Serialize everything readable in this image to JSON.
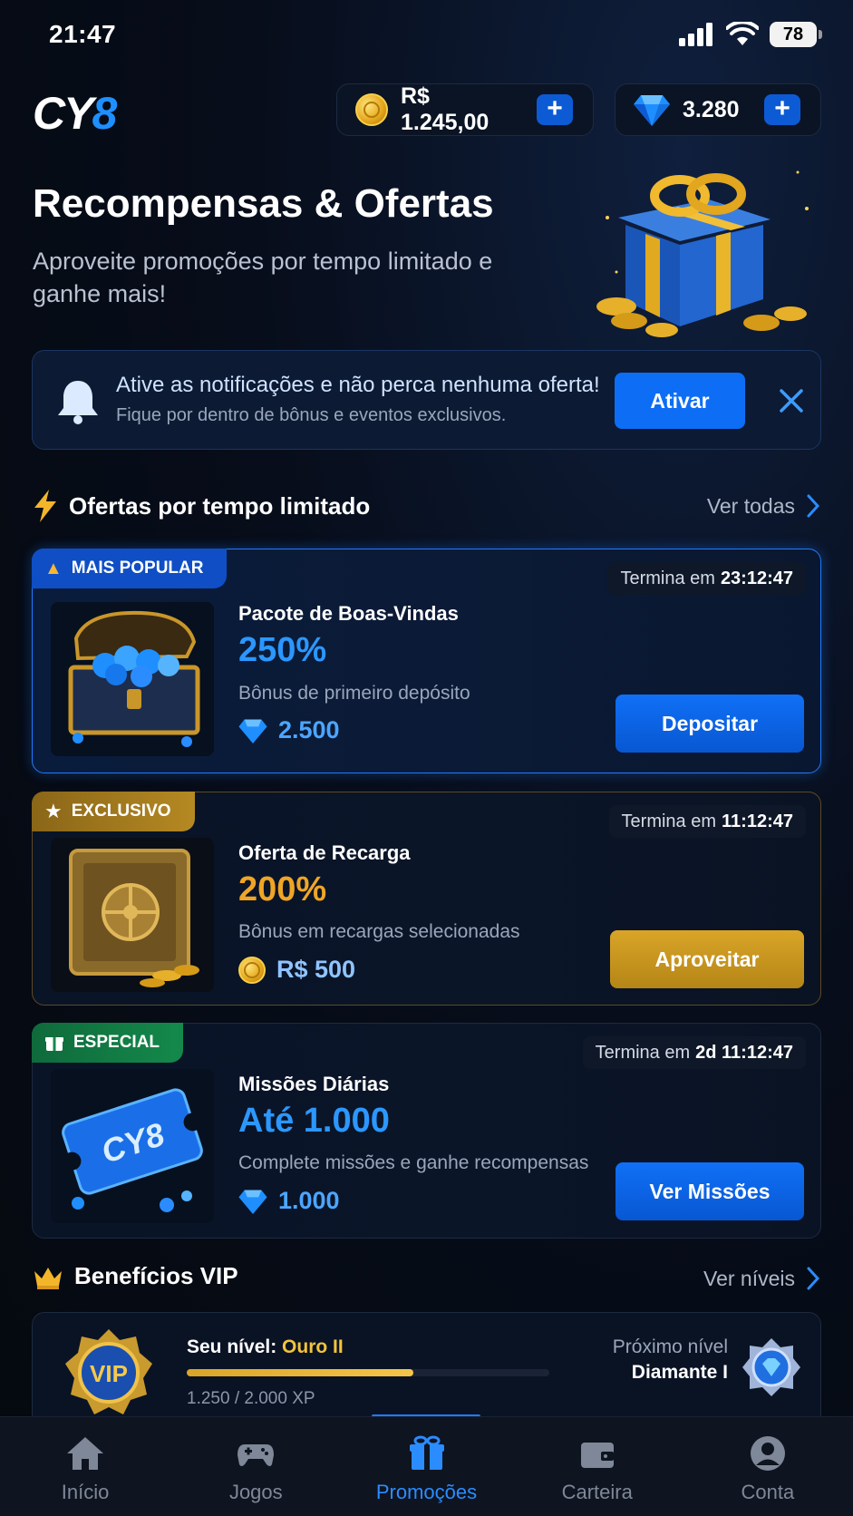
{
  "status_bar": {
    "time": "21:47",
    "battery": "78"
  },
  "header": {
    "logo_part1": "CY",
    "logo_part2": "8",
    "balance": "R$ 1.245,00",
    "gems": "3.280",
    "plus": "+"
  },
  "hero": {
    "title": "Recompensas & Ofertas",
    "subtitle": "Aproveite promoções por tempo limitado e ganhe mais!"
  },
  "notification": {
    "title": "Ative as notificações e não perca nenhuma oferta!",
    "subtitle": "Fique por dentro de bônus e eventos exclusivos.",
    "button": "Ativar"
  },
  "offers_section": {
    "title": "Ofertas por tempo limitado",
    "link": "Ver todas"
  },
  "offers": [
    {
      "tag": "MAIS POPULAR",
      "timer_label": "Termina em",
      "timer_value": "23:12:47",
      "name": "Pacote de Boas-Vindas",
      "highlight": "250%",
      "description": "Bônus de primeiro depósito",
      "reward": "2.500",
      "button": "Depositar"
    },
    {
      "tag": "EXCLUSIVO",
      "timer_label": "Termina em",
      "timer_value": "11:12:47",
      "name": "Oferta de Recarga",
      "highlight": "200%",
      "description": "Bônus em recargas selecionadas",
      "reward": "R$ 500",
      "button": "Aproveitar"
    },
    {
      "tag": "ESPECIAL",
      "timer_label": "Termina em",
      "timer_value": "2d 11:12:47",
      "name": "Missões Diárias",
      "highlight": "Até 1.000",
      "description": "Complete missões e ganhe recompensas",
      "reward": "1.000",
      "button": "Ver Missões",
      "ticket_text": "CY8"
    }
  ],
  "vip_section": {
    "title": "Benefícios VIP",
    "link": "Ver níveis"
  },
  "vip": {
    "badge_text": "VIP",
    "level_label": "Seu nível:",
    "level_value": "Ouro II",
    "xp_text": "1.250 / 2.000 XP",
    "xp_progress": 0.625,
    "next_label": "Próximo nível",
    "next_value": "Diamante I"
  },
  "tabs": [
    {
      "label": "Início",
      "icon": "home-icon"
    },
    {
      "label": "Jogos",
      "icon": "gamepad-icon"
    },
    {
      "label": "Promoções",
      "icon": "gift-icon",
      "active": true
    },
    {
      "label": "Carteira",
      "icon": "wallet-icon"
    },
    {
      "label": "Conta",
      "icon": "user-icon"
    }
  ],
  "colors": {
    "accent_blue": "#0d6ef5",
    "gold": "#d9a528",
    "highlight_blue": "#2b97ff",
    "highlight_gold": "#f0a526",
    "background": "#060b15"
  }
}
